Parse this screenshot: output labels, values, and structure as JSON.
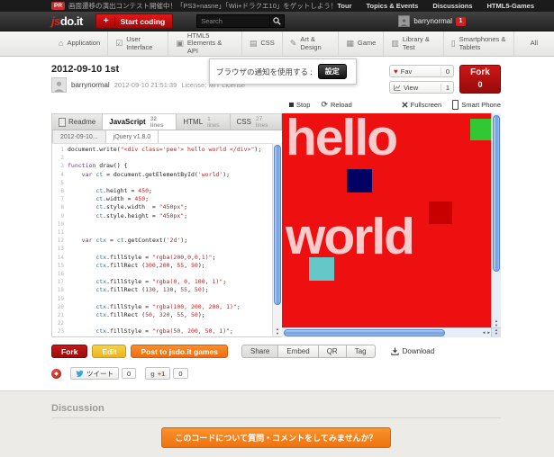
{
  "pr_bar": {
    "badge": "PR",
    "text": "画面遷移の演出コンテスト開催中！「PS3+nasne」「Wii+ドラクエ10」をゲットしよう！",
    "links": [
      "Tour",
      "Topics & Events",
      "Discussions",
      "HTML5-Games"
    ]
  },
  "header": {
    "logo_js": "js",
    "logo_rest": "do.it",
    "plus": "+",
    "start_coding": "Start coding",
    "search_placeholder": "Search",
    "username": "barrynormal",
    "notification_count": "1"
  },
  "nav": {
    "items": [
      {
        "label": "Application"
      },
      {
        "label": "User Interface"
      },
      {
        "label": "HTML5 Elements & API"
      },
      {
        "label": "CSS"
      },
      {
        "label": "Art & Design"
      },
      {
        "label": "Game"
      },
      {
        "label": "Library & Test"
      },
      {
        "label": "Smartphones & Tablets"
      },
      {
        "label": "All"
      }
    ]
  },
  "page": {
    "title": "2012-09-10 1st",
    "author": "barrynormal",
    "timestamp": "2012-09-10 21:51:39",
    "license": "License: MIT License"
  },
  "notification": {
    "text": "ブラウザの通知を使用する :",
    "button": "設定"
  },
  "stats": {
    "fav_label": "Fav",
    "fav_count": "0",
    "view_label": "View",
    "view_count": "1",
    "fork_label": "Fork",
    "fork_count": "0"
  },
  "preview_controls": {
    "stop": "Stop",
    "reload": "Reload",
    "fullscreen": "Fullscreen",
    "smartphone": "Smart Phone"
  },
  "editor": {
    "tabs": [
      {
        "label": "Readme",
        "lines": ""
      },
      {
        "label": "JavaScript",
        "lines": "32 lines"
      },
      {
        "label": "HTML",
        "lines": "1 lines"
      },
      {
        "label": "CSS",
        "lines": "27 lines"
      }
    ],
    "subtabs": [
      "2012-09-10...",
      "jQuery v1.8.0"
    ],
    "code": [
      "document.write(\"<div class='pee'> hello world </div>\");",
      "",
      "function draw() {",
      "    var ct = document.getElementById('world');",
      "",
      "        ct.height = 450;",
      "        ct.width = 450;",
      "        ct.style.width  = \"450px\";",
      "        ct.style.height = \"450px\";",
      "",
      "",
      "    var ctx = ct.getContext('2d');",
      "",
      "        ctx.fillStyle = \"rgba(200,0,0,1)\";",
      "        ctx.fillRect (300,200, 55, 50);",
      "",
      "        ctx.fillStyle = \"rgba(0, 0, 100, 1)\";",
      "        ctx.fillRect (130, 130, 55, 50);",
      "",
      "        ctx.fillStyle = \"rgba(100, 200, 200, 1)\";",
      "        ctx.fillRect (50, 320, 55, 50);",
      "",
      "        ctx.fillStyle = \"rgba(50, 200, 50, 1)\";"
    ]
  },
  "preview": {
    "text_line1": "hello",
    "text_line2": "world",
    "background": "#ee1010",
    "squares": [
      {
        "name": "dark-red-square",
        "color": "#c80000"
      },
      {
        "name": "navy-square",
        "color": "#000064"
      },
      {
        "name": "teal-square",
        "color": "#64c8c8"
      },
      {
        "name": "green-square",
        "color": "#32c832"
      }
    ]
  },
  "actions": {
    "fork": "Fork",
    "edit": "Edit",
    "post_games": "Post to jsdo.it games",
    "share": "Share",
    "embed": "Embed",
    "qr": "QR",
    "tag": "Tag",
    "download": "Download"
  },
  "social": {
    "tweet_label": "ツイート",
    "tweet_count": "0",
    "plusone_g": "g",
    "plusone_label": "+1",
    "plusone_count": "0"
  },
  "discussion": {
    "heading": "Discussion",
    "cta": "このコードについて質問・コメントをしてみませんか？"
  }
}
